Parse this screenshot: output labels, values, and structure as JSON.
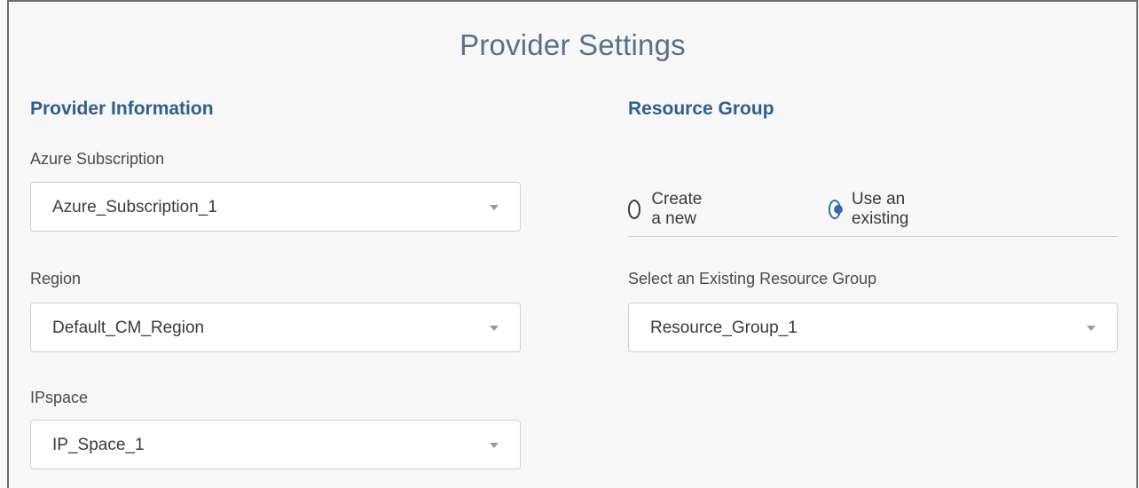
{
  "page": {
    "title": "Provider Settings"
  },
  "provider_info": {
    "heading": "Provider Information",
    "fields": {
      "subscription": {
        "label": "Azure Subscription",
        "value": "Azure_Subscription_1"
      },
      "region": {
        "label": "Region",
        "value": "Default_CM_Region"
      },
      "ipspace": {
        "label": "IPspace",
        "value": "IP_Space_1"
      }
    }
  },
  "resource_group": {
    "heading": "Resource Group",
    "options": {
      "create_new": "Create a new",
      "use_existing": "Use an existing"
    },
    "selected_option": "use_existing",
    "existing": {
      "label": "Select an Existing Resource Group",
      "value": "Resource_Group_1"
    }
  },
  "colors": {
    "title": "#5b6f8c",
    "heading": "#2f5f8f",
    "radio_accent": "#2f6bb0"
  },
  "icons": {
    "select_caret": "caret-down-icon",
    "radio_selected": "radio-selected-icon",
    "radio_unselected": "radio-unselected-icon"
  }
}
